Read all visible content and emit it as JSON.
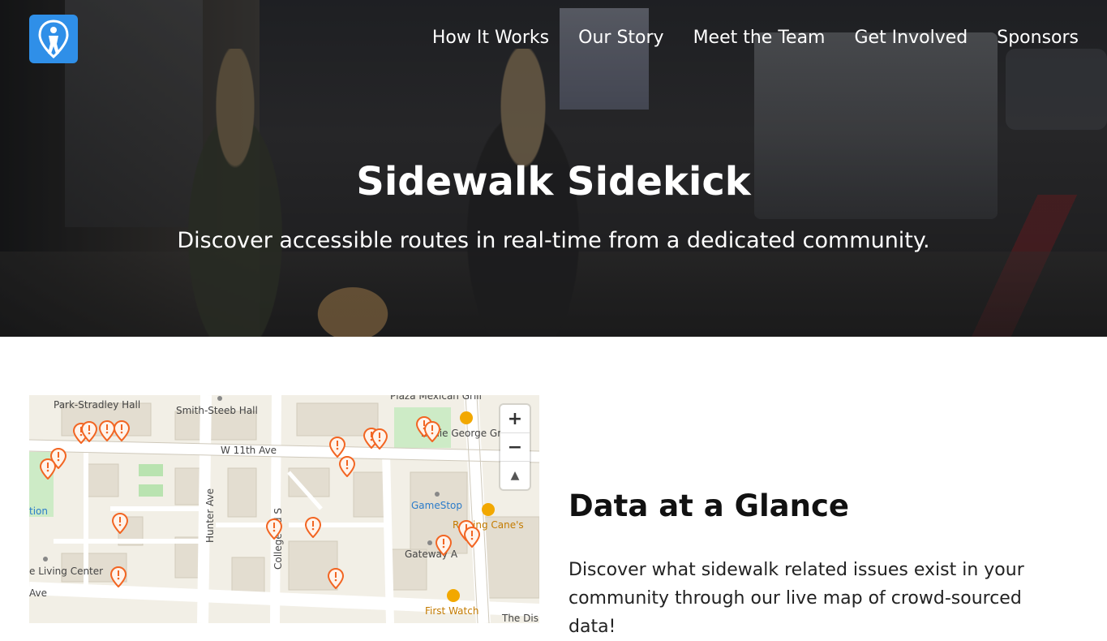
{
  "nav": {
    "items": [
      {
        "label": "How It Works"
      },
      {
        "label": "Our Story"
      },
      {
        "label": "Meet the Team"
      },
      {
        "label": "Get Involved"
      },
      {
        "label": "Sponsors"
      }
    ]
  },
  "hero": {
    "title": "Sidewalk Sidekick",
    "subtitle": "Discover accessible routes in real-time from a dedicated community."
  },
  "map": {
    "labels": {
      "park_stradley": "Park-Stradley Hall",
      "smith_steeb": "Smith-Steeb Hall",
      "w11th": "W 11th Ave",
      "eddie_george": "Eddie George Gr",
      "plaza": "Plaza Mexican Grill",
      "gamestop": "GameStop",
      "raising_canes": "Raising Cane's",
      "gateway": "Gateway A",
      "first_watch": "First Watch",
      "the_dis": "The Dis",
      "hunter": "Hunter Ave",
      "college": "College Rd S",
      "living_center": "e Living Center",
      "tion": "tion",
      "ave": "Ave"
    },
    "zoom_in": "+",
    "zoom_out": "−",
    "compass": "▲"
  },
  "section": {
    "title": "Data at a Glance",
    "body": "Discover what sidewalk related issues exist in your community through our live map of crowd-sourced data!"
  },
  "colors": {
    "logo_bg": "#2f8fe8",
    "pin": "#f26522"
  }
}
